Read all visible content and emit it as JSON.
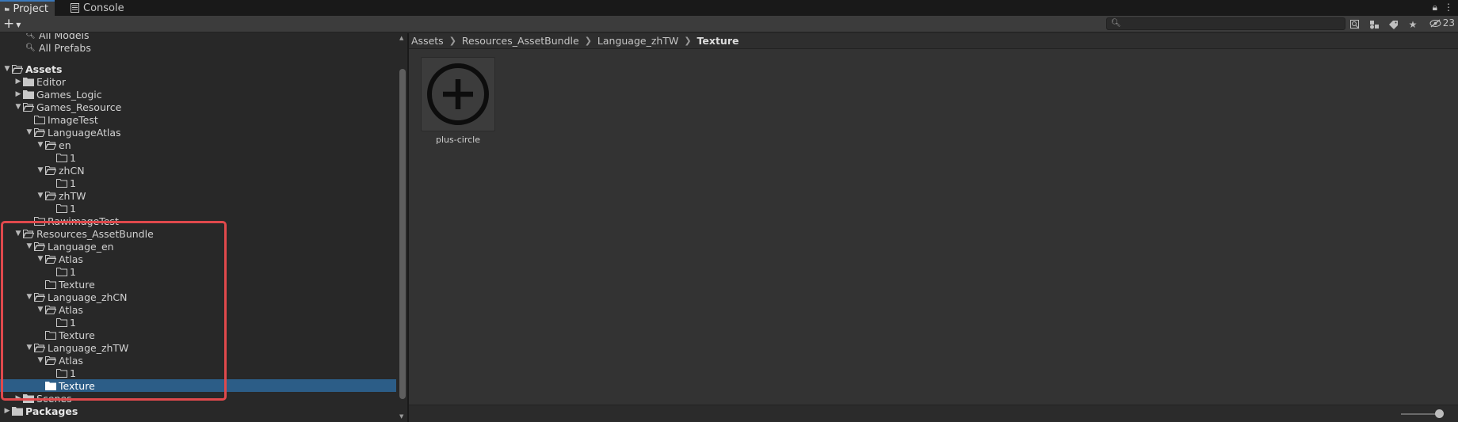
{
  "tabs": [
    {
      "label": "Project",
      "icon": "folder-icon",
      "active": true
    },
    {
      "label": "Console",
      "icon": "console-icon",
      "active": false
    }
  ],
  "toolbar": {
    "create_label": "+",
    "search_placeholder": "",
    "hidden_count": "23"
  },
  "tree": {
    "favorites": [
      {
        "label": "All Models"
      },
      {
        "label": "All Prefabs"
      }
    ],
    "rows": [
      {
        "label": "Assets",
        "depth": 0,
        "expanded": true,
        "bold": true
      },
      {
        "label": "Editor",
        "depth": 1,
        "expanded": false
      },
      {
        "label": "Games_Logic",
        "depth": 1,
        "expanded": false
      },
      {
        "label": "Games_Resource",
        "depth": 1,
        "expanded": true
      },
      {
        "label": "ImageTest",
        "depth": 2,
        "leaf": true
      },
      {
        "label": "LanguageAtlas",
        "depth": 2,
        "expanded": true
      },
      {
        "label": "en",
        "depth": 3,
        "expanded": true
      },
      {
        "label": "1",
        "depth": 4,
        "leaf": true
      },
      {
        "label": "zhCN",
        "depth": 3,
        "expanded": true
      },
      {
        "label": "1",
        "depth": 4,
        "leaf": true
      },
      {
        "label": "zhTW",
        "depth": 3,
        "expanded": true
      },
      {
        "label": "1",
        "depth": 4,
        "leaf": true
      },
      {
        "label": "RawimageTest",
        "depth": 2,
        "leaf": true
      },
      {
        "label": "Resources_AssetBundle",
        "depth": 1,
        "expanded": true
      },
      {
        "label": "Language_en",
        "depth": 2,
        "expanded": true
      },
      {
        "label": "Atlas",
        "depth": 3,
        "expanded": true
      },
      {
        "label": "1",
        "depth": 4,
        "leaf": true
      },
      {
        "label": "Texture",
        "depth": 3,
        "leaf": true
      },
      {
        "label": "Language_zhCN",
        "depth": 2,
        "expanded": true
      },
      {
        "label": "Atlas",
        "depth": 3,
        "expanded": true
      },
      {
        "label": "1",
        "depth": 4,
        "leaf": true
      },
      {
        "label": "Texture",
        "depth": 3,
        "leaf": true
      },
      {
        "label": "Language_zhTW",
        "depth": 2,
        "expanded": true
      },
      {
        "label": "Atlas",
        "depth": 3,
        "expanded": true
      },
      {
        "label": "1",
        "depth": 4,
        "leaf": true
      },
      {
        "label": "Texture",
        "depth": 3,
        "leaf": true,
        "selected": true
      },
      {
        "label": "Scenes",
        "depth": 1,
        "expanded": false
      },
      {
        "label": "Packages",
        "depth": 0,
        "expanded": false,
        "bold": true
      }
    ]
  },
  "breadcrumb": [
    "Assets",
    "Resources_AssetBundle",
    "Language_zhTW",
    "Texture"
  ],
  "assets": [
    {
      "name": "plus-circle",
      "icon": "plus-circle-icon"
    }
  ],
  "colors": {
    "selection": "#2c5d87",
    "highlight_box": "#e0494c",
    "tab_accent": "#3a79bb"
  }
}
